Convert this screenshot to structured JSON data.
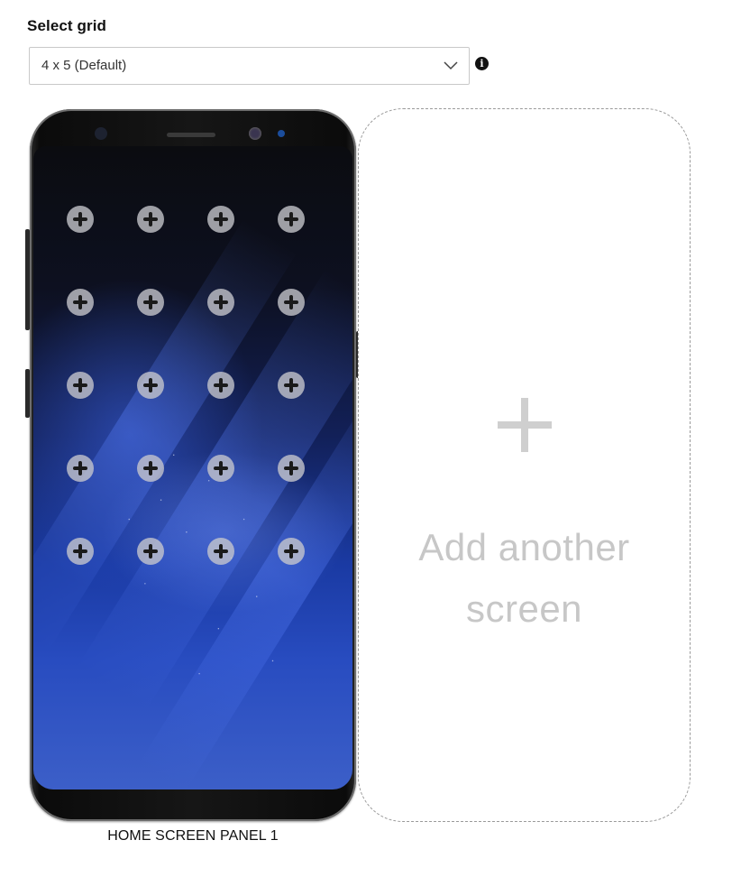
{
  "grid_selector": {
    "label": "Select grid",
    "selected_value": "4 x 5 (Default)",
    "info_icon": "i"
  },
  "phone_panel": {
    "label": "HOME SCREEN PANEL 1",
    "grid_columns": 4,
    "grid_rows": 5
  },
  "add_screen": {
    "text_line1": "Add another",
    "text_line2": "screen"
  },
  "colors": {
    "accent_text": "#111111",
    "placeholder_gray": "#c7c7c7",
    "wallpaper_blue": "#1a3aa3"
  }
}
